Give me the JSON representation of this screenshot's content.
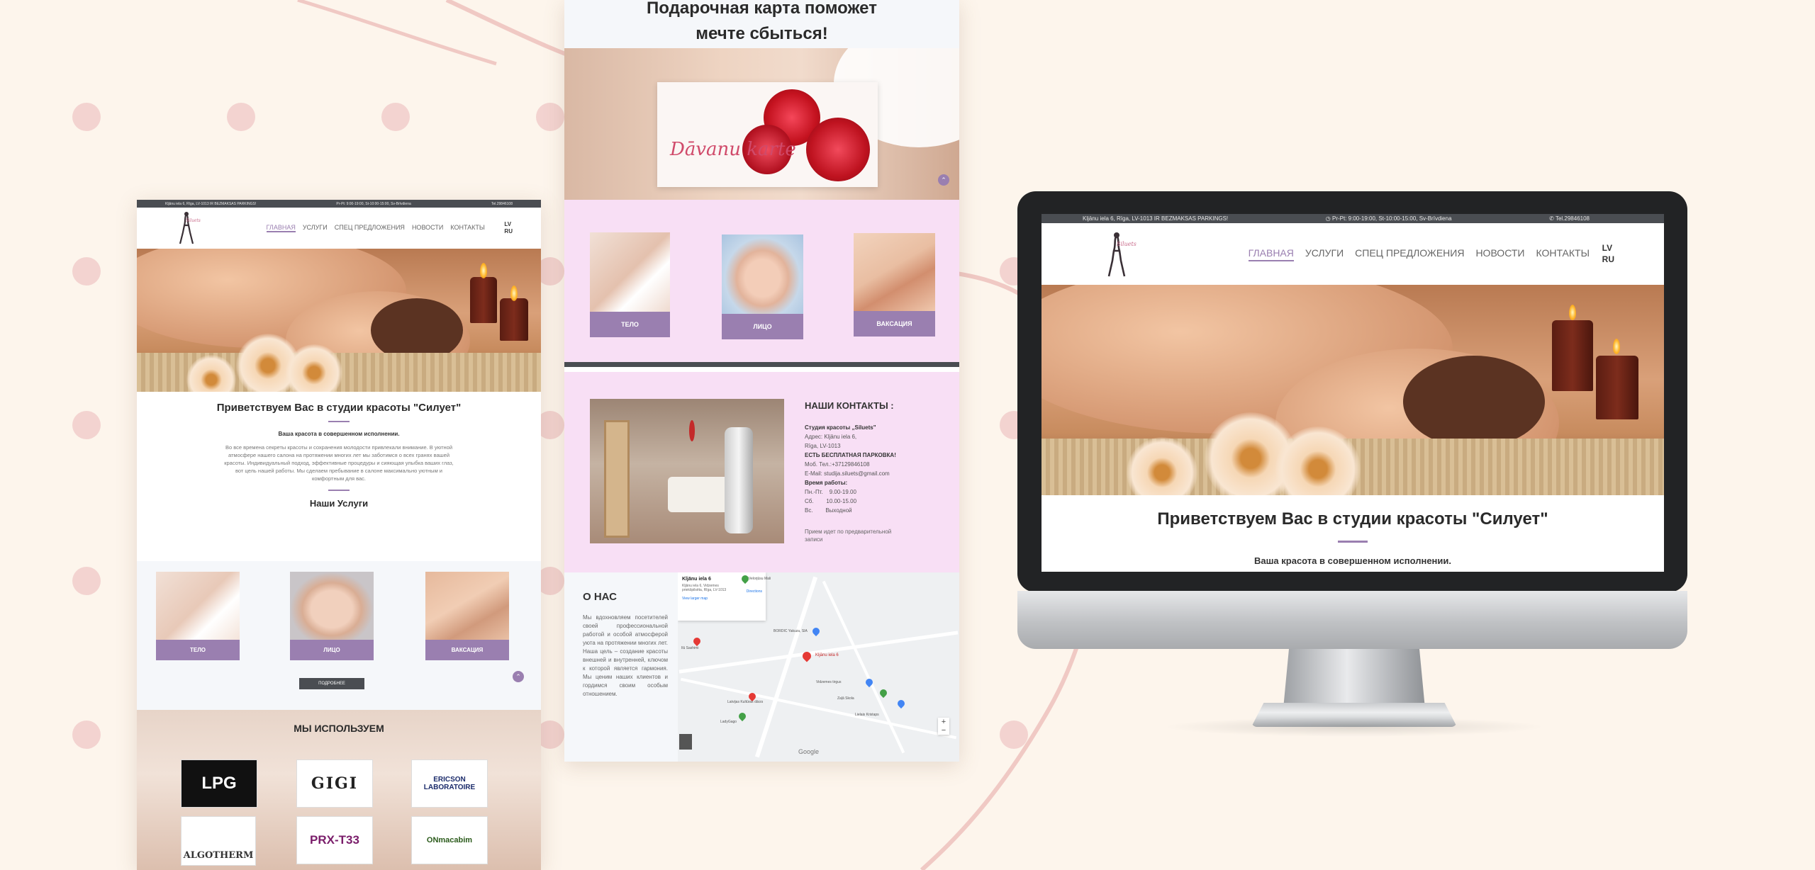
{
  "colors": {
    "accent": "#9a7fb0",
    "topbar": "#4a4d52",
    "pink_section": "#f8dff5",
    "background": "#fdf5ec",
    "dots": "#f3d3d0"
  },
  "site": {
    "topbar": {
      "address": "Kljānu iela 6, Rīga, LV-1013 IR BEZMAKSAS PARKINGS!",
      "hours": "Pr-Pt: 9:00-19:00, St-10:00-15:00, Sv-Brīvdiena",
      "phone": "Tel.29846108"
    },
    "logo_text": "Siluets",
    "nav": [
      "ГЛАВНАЯ",
      "УСЛУГИ",
      "СПЕЦ ПРЕДЛОЖЕНИЯ",
      "НОВОСТИ",
      "КОНТАКТЫ"
    ],
    "langs": [
      "LV",
      "RU"
    ],
    "welcome_title": "Приветствуем Вас в студии красоты \"Силует\"",
    "welcome_subtitle": "Ваша красота в совершенном исполнении.",
    "welcome_body": "Во все времена секреты красоты и сохранения молодости привлекали внимание. В уютной атмосфере нашего салона на протяжении многих лет мы заботимся о всех гранях вашей красоты. Индивидуальный подход, эффективные процедуры и сияющая улыбка ваших глаз, вот цель нашей работы. Мы сделаем пребывание в салоне максимально уютным и комфортным для вас.",
    "services_title": "Наши Услуги",
    "services": [
      "ТЕЛО",
      "ЛИЦО",
      "ВАКСАЦИЯ"
    ],
    "more_button": "ПОДРОБНЕЕ",
    "brands_title": "МЫ ИСПОЛЬЗУЕМ",
    "brands": [
      "LPG",
      "GIGI",
      "ERICSON LABORATOIRE",
      "ALGOTHERM",
      "PRX-T33",
      "ONmacabim"
    ],
    "gift_title": "Подарочная карта поможет мечте сбыться!",
    "gift_card_text": "Dāvanu karte",
    "contacts": {
      "title": "НАШИ КОНТАКТЫ :",
      "lines": [
        "Студия красоты „Siluets\"",
        "Адрес: Kljānu iela 6,",
        "Rīga, LV-1013",
        "ЕСТЬ БЕСПЛАТНАЯ ПАРКОВКА!",
        "Моб. Тел.:+37129846108",
        "E-Mail: studija.siluets@gmail.com",
        "Время работы:",
        "Пн.-Пт.    9.00-19.00",
        "Сб.        10.00-15.00",
        "Вс.        Выходной"
      ],
      "note": "Прием идет по предварительной записи"
    },
    "about": {
      "title": "О НАС",
      "body": "Мы вдохновляем посетителей своей профессиональной работой и особой атмосферой уюта на протяжении многих лет. Наша цель – создание красоты внешней и внутренней, ключом к которой является гармония. Мы ценим наших клиентов и гордимся своим особым отношением."
    },
    "map": {
      "card_title": "Kljānu iela 6",
      "card_address": "Kljānu iela 6, Vidzemes priekšpilsēta, Rīga, LV-1013",
      "directions": "Directions",
      "view_larger": "View larger map",
      "pin_label": "Kljānu iela 6",
      "places": [
        "BORDIC Yakuza, SIA",
        "Ilū Sashimi",
        "Latvijas Kultūras dārzs",
        "Velorjūsu Mali",
        "Vidzemes tirgus",
        "Lielais Kristaps",
        "LadyGago",
        "Zaļā Skola"
      ],
      "google": "Google",
      "zoom_in": "+",
      "zoom_out": "−"
    }
  }
}
